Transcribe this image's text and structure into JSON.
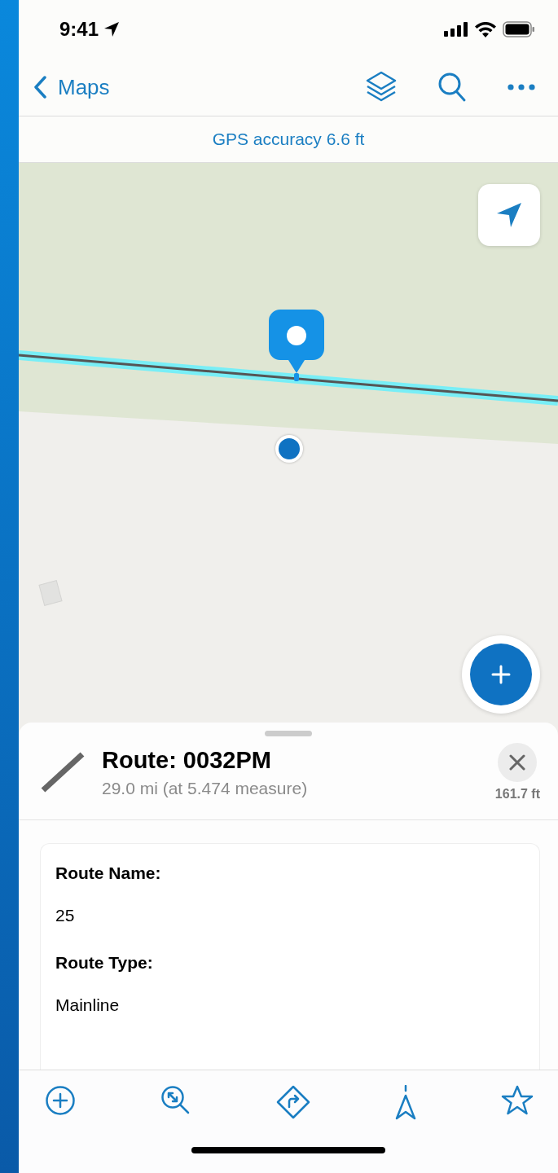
{
  "status_bar": {
    "time": "9:41"
  },
  "nav_bar": {
    "back_label": "Maps"
  },
  "gps_banner": {
    "text": "GPS accuracy 6.6 ft"
  },
  "feature_sheet": {
    "title": "Route: 0032PM",
    "subtitle": "29.0 mi (at 5.474 measure)",
    "distance": "161.7 ft",
    "fields": [
      {
        "label": "Route Name:",
        "value": "25"
      },
      {
        "label": "Route Type:",
        "value": "Mainline"
      }
    ]
  }
}
